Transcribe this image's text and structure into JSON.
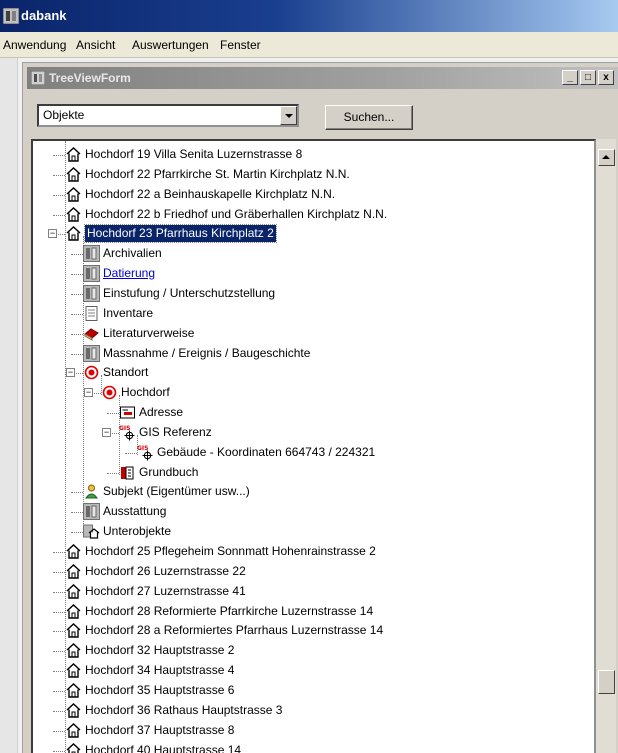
{
  "app": {
    "title": "dabank",
    "menu": [
      "Anwendung",
      "Ansicht",
      "Auswertungen",
      "Fenster"
    ]
  },
  "window": {
    "title": "TreeViewForm",
    "buttons": {
      "minimize": "_",
      "maximize": "□",
      "close": "x"
    }
  },
  "toolbar": {
    "dropdown_value": "Objekte",
    "search_label": "Suchen..."
  },
  "tree": {
    "items": [
      {
        "label": "Hochdorf 19 Villa Senita Luzernstrasse 8",
        "icon": "house-icon",
        "level": 0
      },
      {
        "label": "Hochdorf 22 Pfarrkirche St. Martin  Kirchplatz N.N.",
        "icon": "house-icon",
        "level": 0
      },
      {
        "label": "Hochdorf 22 a Beinhauskapelle  Kirchplatz N.N.",
        "icon": "house-icon",
        "level": 0
      },
      {
        "label": "Hochdorf 22 b Friedhof und Gräberhallen  Kirchplatz N.N.",
        "icon": "house-icon",
        "level": 0
      },
      {
        "label": "Hochdorf 23 Pfarrhaus  Kirchplatz  2",
        "icon": "house-icon",
        "level": 0,
        "expanded": true,
        "selected": true
      },
      {
        "label": "Archivalien",
        "icon": "da-icon",
        "level": 1
      },
      {
        "label": "Datierung",
        "icon": "da-icon",
        "level": 1,
        "link": true
      },
      {
        "label": "Einstufung / Unterschutzstellung",
        "icon": "da-icon",
        "level": 1
      },
      {
        "label": "Inventare",
        "icon": "document-icon",
        "level": 1
      },
      {
        "label": "Literaturverweise",
        "icon": "book-icon",
        "level": 1
      },
      {
        "label": "Massnahme / Ereignis / Baugeschichte",
        "icon": "da-icon",
        "level": 1
      },
      {
        "label": "Standort",
        "icon": "location-icon",
        "level": 1,
        "expanded": true
      },
      {
        "label": "Hochdorf",
        "icon": "location-icon",
        "level": 2,
        "expanded": true
      },
      {
        "label": "Adresse",
        "icon": "address-icon",
        "level": 3
      },
      {
        "label": "GIS Referenz",
        "icon": "gis-icon",
        "level": 3,
        "expanded": true
      },
      {
        "label": "Gebäude - Koordinaten 664743 / 224321",
        "icon": "gis-icon",
        "level": 4
      },
      {
        "label": "Grundbuch",
        "icon": "ledger-icon",
        "level": 3
      },
      {
        "label": "Subjekt (Eigentümer usw...)",
        "icon": "person-icon",
        "level": 1
      },
      {
        "label": "Ausstattung",
        "icon": "da-icon",
        "level": 1
      },
      {
        "label": "Unterobjekte",
        "icon": "subobject-icon",
        "level": 1
      },
      {
        "label": "Hochdorf 25 Pflegeheim Sonnmatt Hohenrainstrasse 2",
        "icon": "house-icon",
        "level": 0
      },
      {
        "label": "Hochdorf 26  Luzernstrasse 22",
        "icon": "house-icon",
        "level": 0
      },
      {
        "label": "Hochdorf 27  Luzernstrasse  41",
        "icon": "house-icon",
        "level": 0
      },
      {
        "label": "Hochdorf 28 Reformierte Pfarrkirche Luzernstrasse  14",
        "icon": "house-icon",
        "level": 0
      },
      {
        "label": "Hochdorf 28 a Reformiertes Pfarrhaus Luzernstrasse 14",
        "icon": "house-icon",
        "level": 0
      },
      {
        "label": "Hochdorf 32  Hauptstrasse  2",
        "icon": "house-icon",
        "level": 0
      },
      {
        "label": "Hochdorf 34  Hauptstrasse 4",
        "icon": "house-icon",
        "level": 0
      },
      {
        "label": "Hochdorf 35  Hauptstrasse 6",
        "icon": "house-icon",
        "level": 0
      },
      {
        "label": "Hochdorf 36 Rathaus Hauptstrasse  3",
        "icon": "house-icon",
        "level": 0
      },
      {
        "label": "Hochdorf 37  Hauptstrasse  8",
        "icon": "house-icon",
        "level": 0
      },
      {
        "label": "Hochdorf 40  Hauptstrasse 14",
        "icon": "house-icon",
        "level": 0
      }
    ],
    "icon_labels": {
      "gis": "GIS",
      "da": "DA"
    }
  },
  "colors": {
    "selection": "#0a246a",
    "link": "#0000cc",
    "location_red": "#e00000"
  }
}
